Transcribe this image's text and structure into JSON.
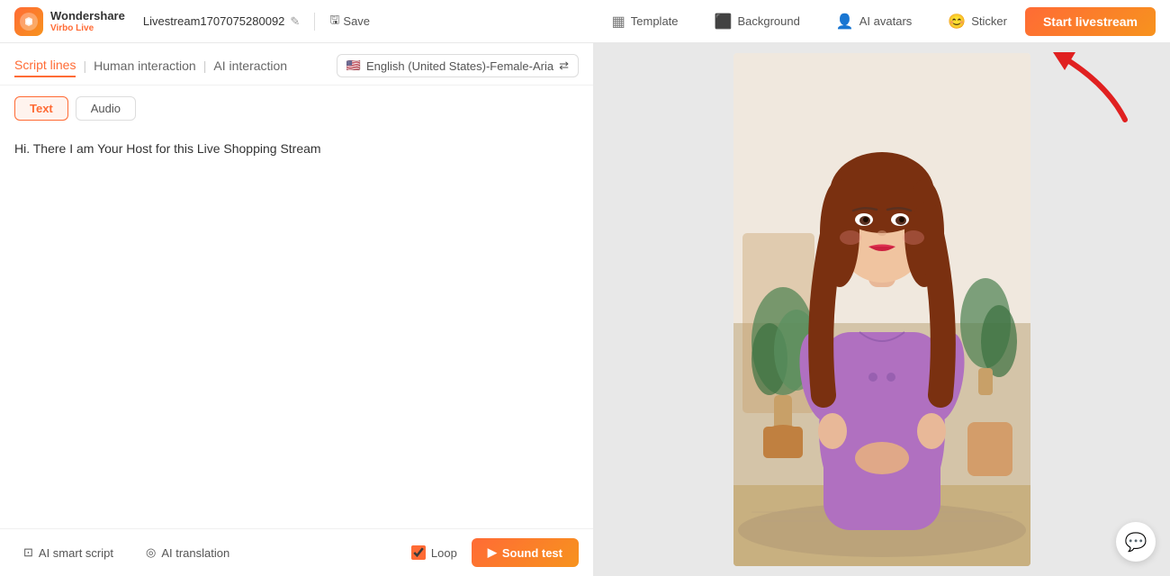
{
  "app": {
    "logo_brand": "Wondershare",
    "logo_product": "Virbo Live",
    "stream_title": "Livestream1707075280092",
    "save_label": "Save"
  },
  "header_nav": {
    "template_label": "Template",
    "background_label": "Background",
    "ai_avatars_label": "AI avatars",
    "sticker_label": "Sticker",
    "start_livestream_label": "Start livestream"
  },
  "left_panel": {
    "tab_script_lines": "Script lines",
    "tab_human_interaction": "Human interaction",
    "tab_ai_interaction": "AI interaction",
    "lang_selector": "English (United States)-Female-Aria",
    "text_btn": "Text",
    "audio_btn": "Audio",
    "script_content": "Hi. There I am Your Host for this Live Shopping Stream"
  },
  "bottom_bar": {
    "ai_smart_script_label": "AI smart script",
    "ai_translation_label": "AI translation",
    "loop_label": "Loop",
    "sound_test_label": "Sound test"
  }
}
